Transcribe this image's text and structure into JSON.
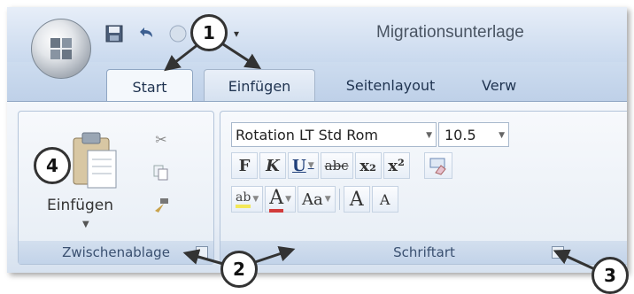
{
  "window": {
    "title": "Migrationsunterlage"
  },
  "quick_access": {
    "icons": [
      "save-icon",
      "undo-icon",
      "redo-icon",
      "customize-arrow-icon"
    ]
  },
  "tabs": [
    {
      "label": "Start",
      "active": true
    },
    {
      "label": "Einfügen",
      "active": false
    },
    {
      "label": "Seitenlayout",
      "active": false
    },
    {
      "label": "Verw",
      "active": false
    }
  ],
  "groups": {
    "clipboard": {
      "label": "Zwischenablage",
      "paste_label": "Einfügen",
      "icons": [
        "paste-icon",
        "cut-icon",
        "copy-icon",
        "format-painter-icon"
      ]
    },
    "font": {
      "label": "Schriftart",
      "font_name": "Rotation LT Std Rom",
      "font_size": "10.5",
      "buttons_row1": [
        "F",
        "K",
        "U",
        "abc",
        "x₂",
        "x²"
      ],
      "buttons_row2": [
        "ab",
        "A",
        "Aa",
        "A",
        "A"
      ]
    }
  },
  "callouts": [
    "1",
    "2",
    "3",
    "4"
  ],
  "colors": {
    "ribbon_bg": "#e8eef6",
    "tab_text": "#1f3350",
    "accent": "#8fa6c3"
  }
}
